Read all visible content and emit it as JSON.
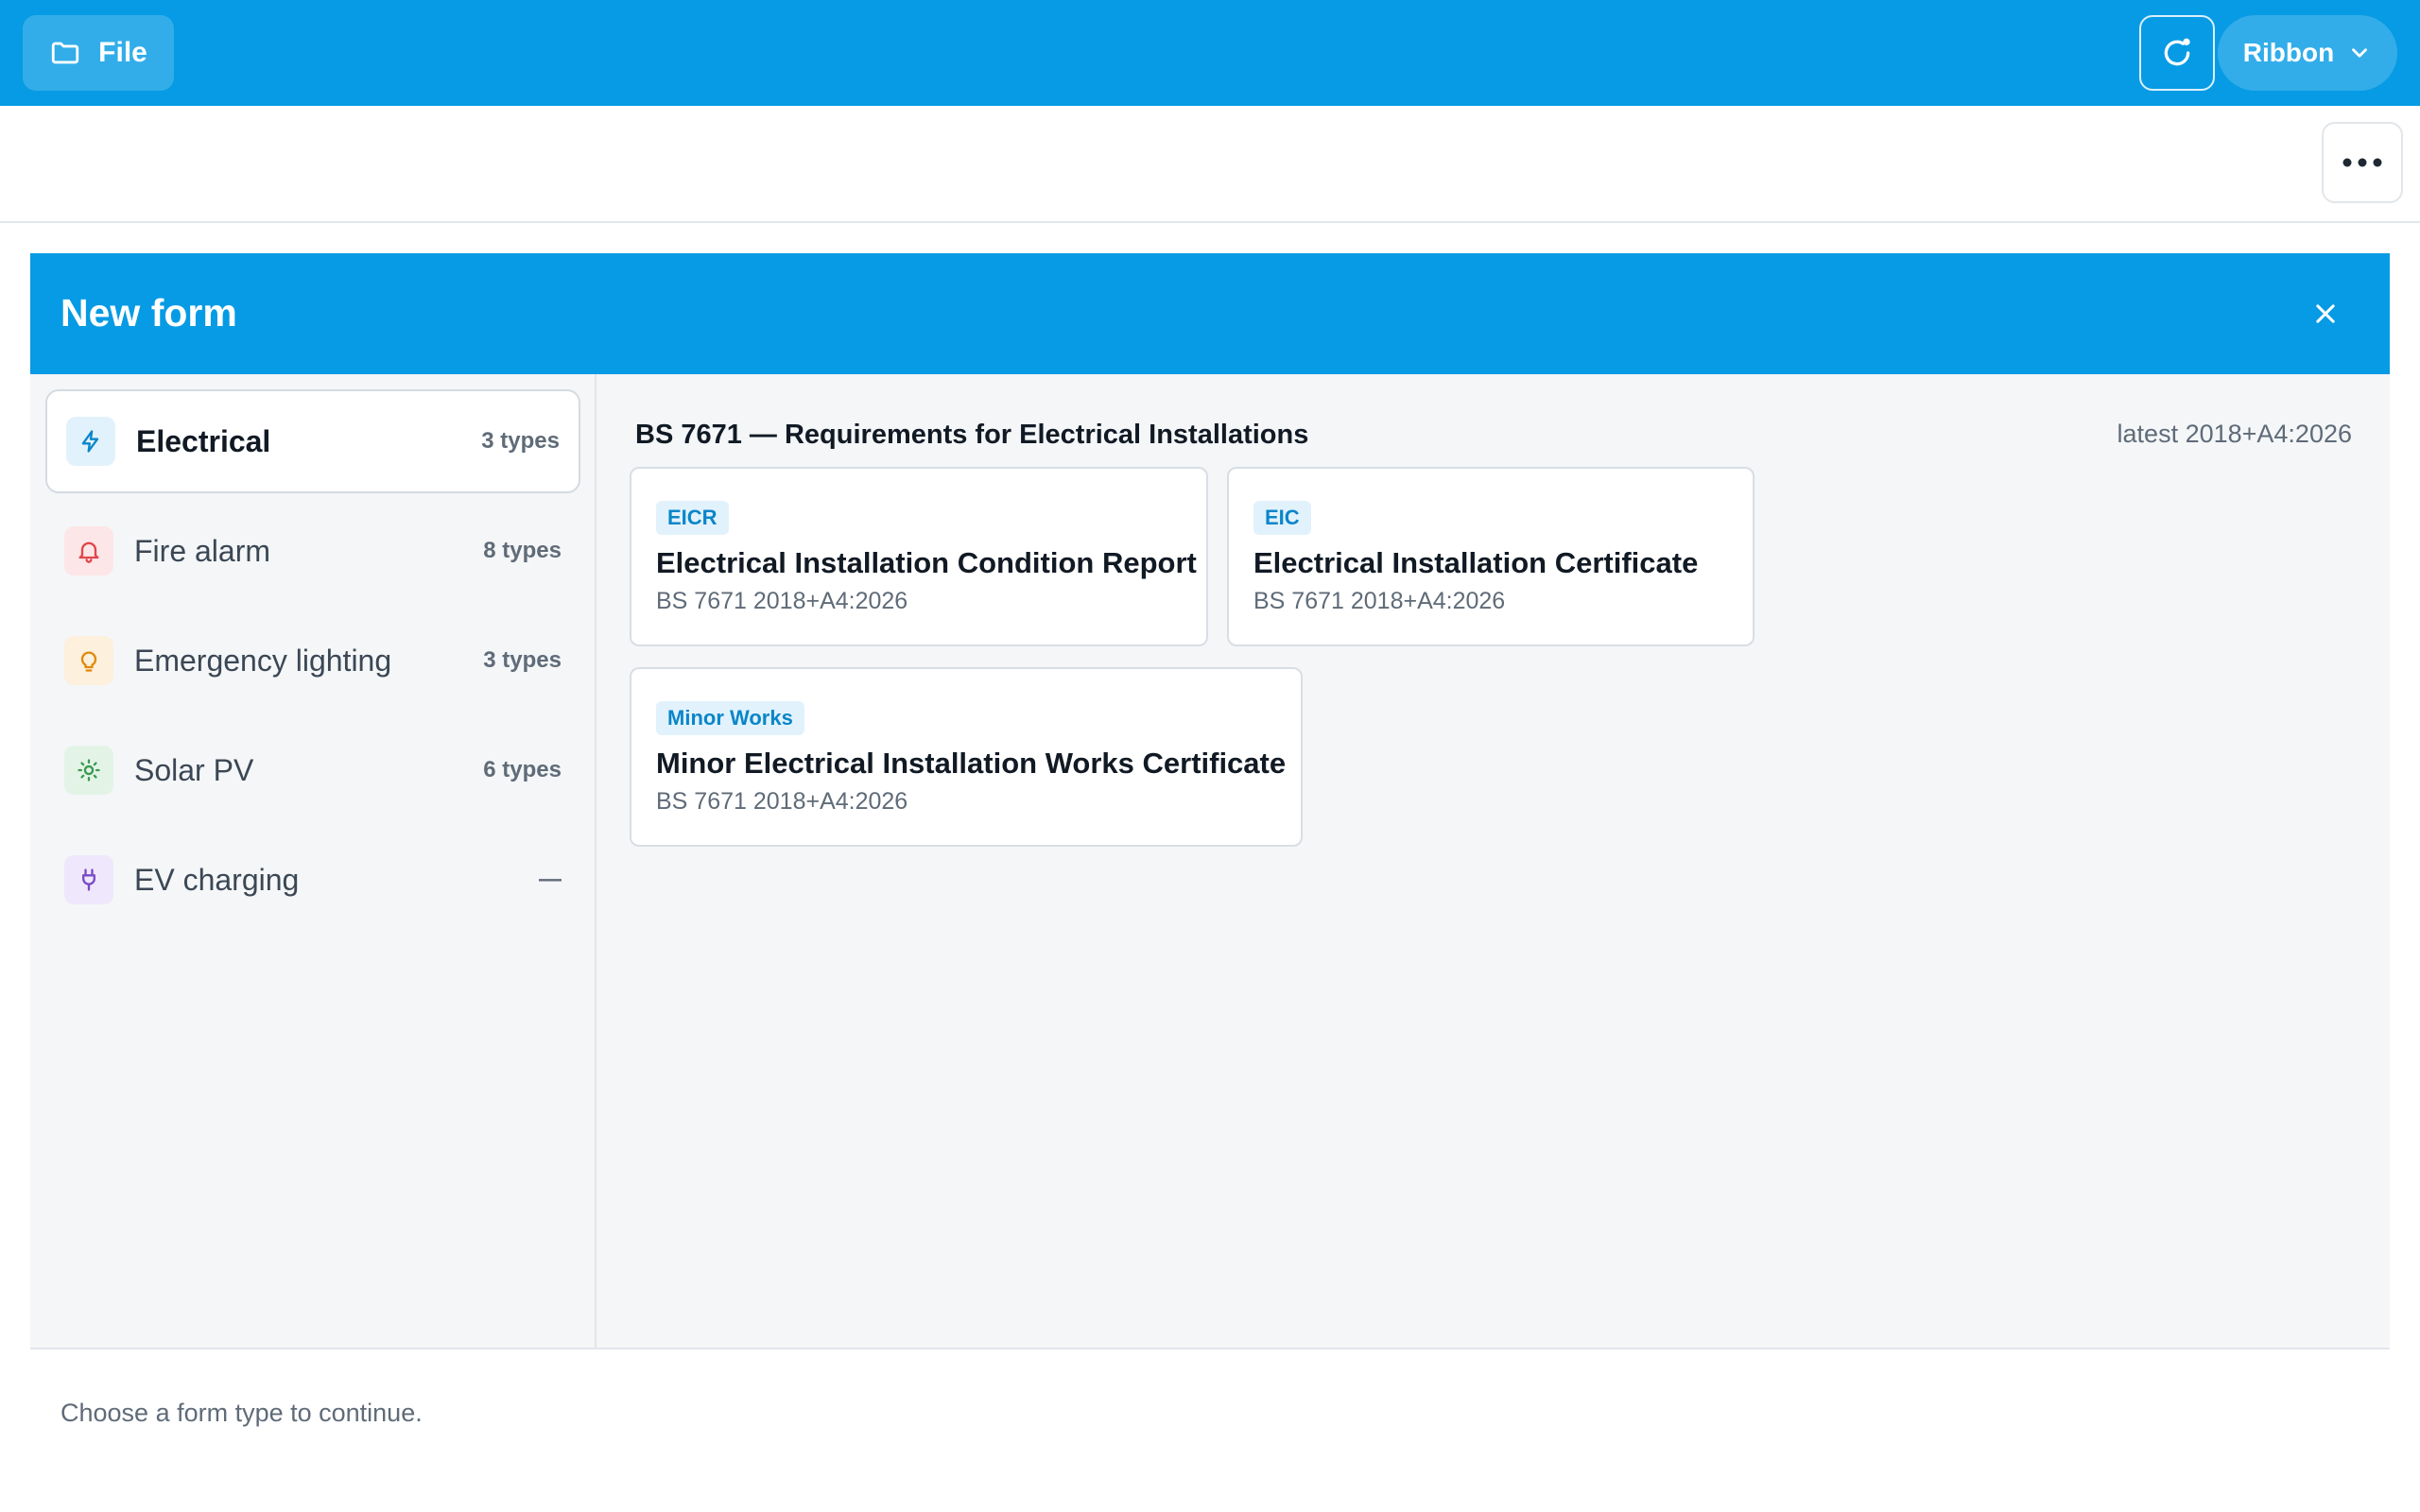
{
  "topbar": {
    "file_label": "File",
    "ribbon_label": "Ribbon"
  },
  "modal": {
    "title": "New form",
    "footer_hint": "Choose a form type to continue."
  },
  "categories": [
    {
      "label": "Electrical",
      "count": "3 types",
      "icon": "lightning-icon",
      "active": true,
      "icon_color": "#0a86c9",
      "icon_bg": "#e2f2fc"
    },
    {
      "label": "Fire alarm",
      "count": "8 types",
      "icon": "bell-icon",
      "active": false,
      "icon_color": "#e0474c",
      "icon_bg": "#fde6e7"
    },
    {
      "label": "Emergency lighting",
      "count": "3 types",
      "icon": "lightbulb-icon",
      "active": false,
      "icon_color": "#e08a0b",
      "icon_bg": "#fdf0dc"
    },
    {
      "label": "Solar PV",
      "count": "6 types",
      "icon": "sun-icon",
      "active": false,
      "icon_color": "#3a9a52",
      "icon_bg": "#e3f4e7"
    },
    {
      "label": "EV charging",
      "count": "—",
      "icon": "plug-icon",
      "active": false,
      "icon_color": "#7a4bc8",
      "icon_bg": "#efe7fb"
    }
  ],
  "section": {
    "title": "BS 7671 — Requirements for Electrical Installations",
    "meta": "latest 2018+A4:2026"
  },
  "forms": [
    {
      "badge": "EICR",
      "title": "Electrical Installation Condition Report",
      "subtitle": "BS 7671 2018+A4:2026"
    },
    {
      "badge": "EIC",
      "title": "Electrical Installation Certificate",
      "subtitle": "BS 7671 2018+A4:2026"
    },
    {
      "badge": "Minor Works",
      "title": "Minor Electrical Installation Works Certificate",
      "subtitle": "BS 7671 2018+A4:2026"
    }
  ],
  "colors": {
    "brand": "#069be4",
    "panel_bg": "#f4f6f8",
    "badge_bg": "#e2f2fc",
    "badge_text": "#0a86c9"
  }
}
